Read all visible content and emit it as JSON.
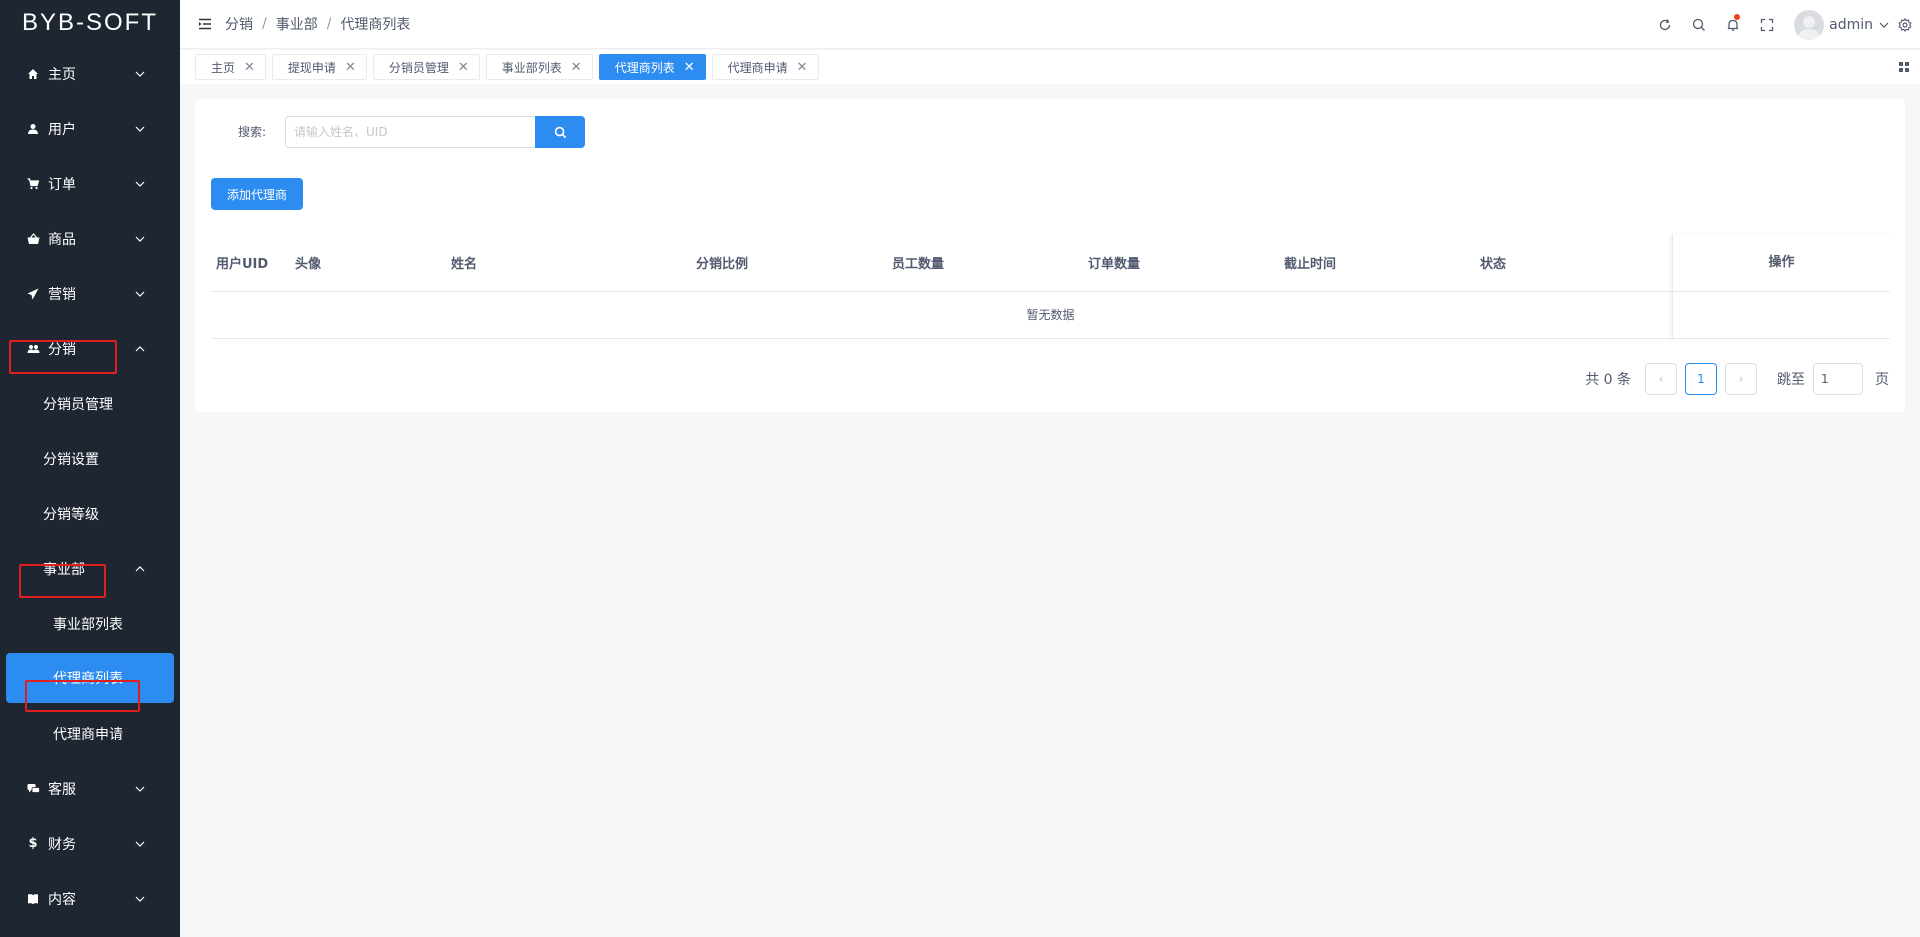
{
  "app": {
    "logo": "BYB-SOFT"
  },
  "sidebar": {
    "items": [
      {
        "label": "主页",
        "icon": "home-icon",
        "expanded": false
      },
      {
        "label": "用户",
        "icon": "user-icon",
        "expanded": false
      },
      {
        "label": "订单",
        "icon": "cart-icon",
        "expanded": false
      },
      {
        "label": "商品",
        "icon": "basket-icon",
        "expanded": false
      },
      {
        "label": "营销",
        "icon": "send-icon",
        "expanded": false
      },
      {
        "label": "分销",
        "icon": "group-icon",
        "expanded": true
      },
      {
        "label": "客服",
        "icon": "chat-icon",
        "expanded": false
      },
      {
        "label": "财务",
        "icon": "dollar-icon",
        "expanded": false
      },
      {
        "label": "内容",
        "icon": "book-icon",
        "expanded": false
      }
    ],
    "distribution_sub": [
      "分销员管理",
      "分销设置",
      "分销等级"
    ],
    "division": {
      "label": "事业部",
      "expanded": true
    },
    "division_sub": [
      "事业部列表",
      "代理商列表",
      "代理商申请"
    ],
    "active": "代理商列表"
  },
  "header": {
    "breadcrumb": [
      "分销",
      "事业部",
      "代理商列表"
    ],
    "username": "admin",
    "accent": "#2d8cf0",
    "notification_dot": "#ed4014"
  },
  "tabs": [
    {
      "label": "主页",
      "active": false
    },
    {
      "label": "提现申请",
      "active": false
    },
    {
      "label": "分销员管理",
      "active": false
    },
    {
      "label": "事业部列表",
      "active": false
    },
    {
      "label": "代理商列表",
      "active": true
    },
    {
      "label": "代理商申请",
      "active": false
    }
  ],
  "search": {
    "label": "搜索:",
    "placeholder": "请输入姓名、UID",
    "value": ""
  },
  "actions": {
    "add_label": "添加代理商"
  },
  "table": {
    "columns": [
      "用户UID",
      "头像",
      "姓名",
      "分销比例",
      "员工数量",
      "订单数量",
      "截止时间",
      "状态",
      "操作"
    ],
    "rows": [],
    "empty_text": "暂无数据"
  },
  "pagination": {
    "total_text": "共 0 条",
    "current_page": "1",
    "prev": "‹",
    "next": "›",
    "jump_label": "跳至",
    "jump_value": "1",
    "page_suffix": "页"
  }
}
